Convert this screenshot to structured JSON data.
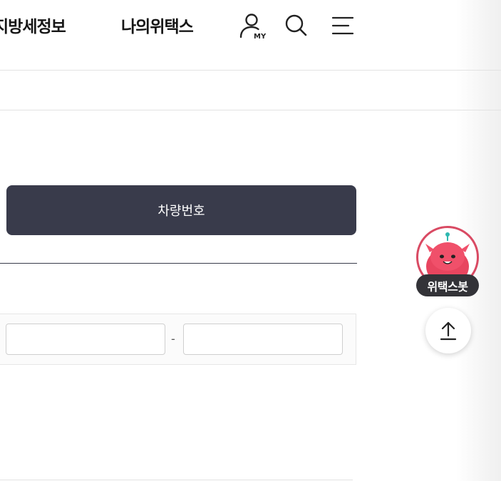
{
  "header": {
    "nav": [
      {
        "label": "지방세정보"
      },
      {
        "label": "나의위택스"
      }
    ],
    "my_icon_text": "MY",
    "icons": [
      "my-user-icon",
      "search-icon",
      "menu-icon"
    ]
  },
  "tabs": {
    "active_label": "차량번호"
  },
  "form": {
    "field_1_value": "",
    "field_2_value": "",
    "separator": "-"
  },
  "chatbot": {
    "label": "위택스봇",
    "accent_color": "#d94a63"
  },
  "scroll_top": {
    "icon": "arrow-up-icon"
  },
  "colors": {
    "tab_active_bg": "#393b4b",
    "tab_active_text": "#ffffff"
  }
}
